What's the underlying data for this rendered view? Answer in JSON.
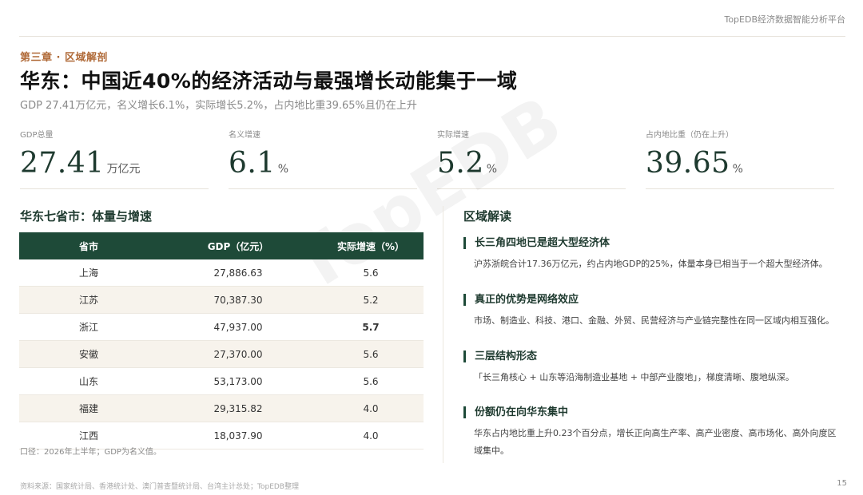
{
  "brand": "TopEDB经济数据智能分析平台",
  "chapter": "第三章 · 区域解剖",
  "title": "华东：中国近40%的经济活动与最强增长动能集于一域",
  "subtitle": "GDP 27.41万亿元，名义增长6.1%，实际增长5.2%，占内地比重39.65%且仍在上升",
  "kpis": [
    {
      "label": "GDP总量",
      "value": "27.41",
      "unit": "万亿元"
    },
    {
      "label": "名义增速",
      "value": "6.1",
      "unit": "%"
    },
    {
      "label": "实际增速",
      "value": "5.2",
      "unit": "%"
    },
    {
      "label": "占内地比重（仍在上升）",
      "value": "39.65",
      "unit": "%"
    }
  ],
  "table_section": {
    "title": "华东七省市：体量与增速",
    "headers": [
      "省市",
      "GDP（亿元）",
      "实际增速（%）"
    ],
    "rows": [
      {
        "name": "上海",
        "gdp": "27,886.63",
        "growth": "5.6"
      },
      {
        "name": "江苏",
        "gdp": "70,387.30",
        "growth": "5.2"
      },
      {
        "name": "浙江",
        "gdp": "47,937.00",
        "growth": "5.7"
      },
      {
        "name": "安徽",
        "gdp": "27,370.00",
        "growth": "5.6"
      },
      {
        "name": "山东",
        "gdp": "53,173.00",
        "growth": "5.6"
      },
      {
        "name": "福建",
        "gdp": "29,315.82",
        "growth": "4.0"
      },
      {
        "name": "江西",
        "gdp": "18,037.90",
        "growth": "4.0"
      }
    ],
    "note": "口径：2026年上半年；GDP为名义值。"
  },
  "watermark": "TopEDB",
  "interpretation": {
    "title": "区域解读",
    "items": [
      {
        "heading": "长三角四地已是超大型经济体",
        "body": "沪苏浙皖合计17.36万亿元，约占内地GDP的25%，体量本身已相当于一个超大型经济体。"
      },
      {
        "heading": "真正的优势是网络效应",
        "body": "市场、制造业、科技、港口、金融、外贸、民营经济与产业链完整性在同一区域内相互强化。"
      },
      {
        "heading": "三层结构形态",
        "body": "「长三角核心 + 山东等沿海制造业基地 + 中部产业腹地」，梯度清晰、腹地纵深。"
      },
      {
        "heading": "份额仍在向华东集中",
        "body": "华东占内地比重上升0.23个百分点，增长正向高生产率、高产业密度、高市场化、高外向度区域集中。"
      }
    ]
  },
  "footer": {
    "source": "资料来源：国家统计局、香港统计处、澳门普查暨统计局、台湾主计总处；TopEDB整理",
    "page": "15"
  }
}
